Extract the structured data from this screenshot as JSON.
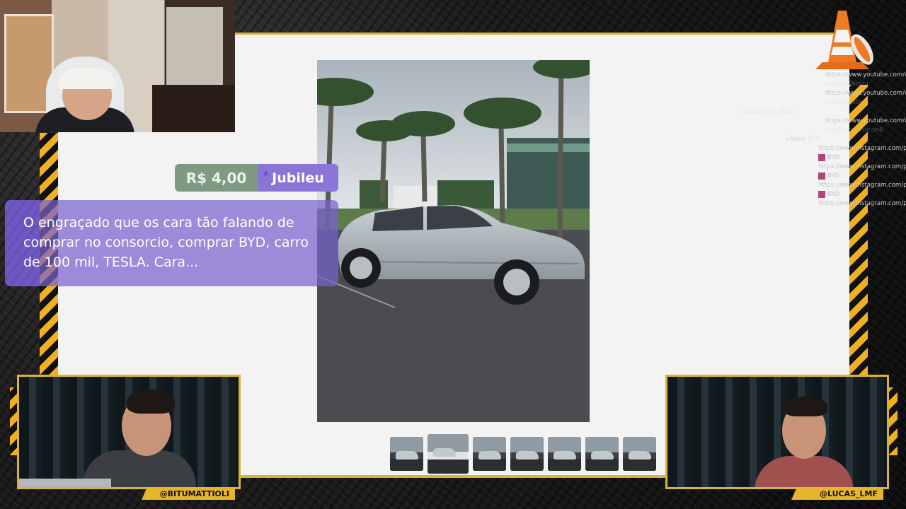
{
  "donation": {
    "amount": "R$ 4,00",
    "donor": "Jubileu",
    "message": "O engraçado que os cara tão falando de comprar no consorcio, comprar BYD, carro de 100 mil, TESLA. Cara..."
  },
  "chat": {
    "lines": [
      {
        "text": "https://www.youtube.com/watch?",
        "style": "indent2"
      },
      {
        "text": "v=xh4jBNlnyu",
        "style": "indent2 muted"
      },
      {
        "text": "https://www.youtube.com/watch?",
        "style": "indent2"
      },
      {
        "text": "v=xh4jBNlnyu",
        "style": "indent2 muted"
      },
      {
        "text": "Lucadd @itsrdtg11",
        "style": "muted"
      },
      {
        "text": "https://www.youtube.com/watch?",
        "style": "indent2"
      },
      {
        "text": "v=ljEoxhwehre-ss4",
        "style": "indent2 muted"
      }
    ],
    "user": "v1nox",
    "user_msg": "BYD",
    "links": [
      "https://www.instagram.com/p",
      "BYD",
      "https://www.instagram.com/p",
      "BYD",
      "https://www.instagram.com/p",
      "BYD",
      "https://www.instagram.com/p"
    ]
  },
  "gallery": {
    "thumbnail_count": 7,
    "active_index": 1
  },
  "cams": {
    "left_handle": "@BITUMATTIOLI",
    "right_handle": "@LUCAS_LMF"
  },
  "colors": {
    "accent_yellow": "#e7b52c",
    "donation_purple": "#8a74d6",
    "donation_green": "#7f9a83"
  }
}
